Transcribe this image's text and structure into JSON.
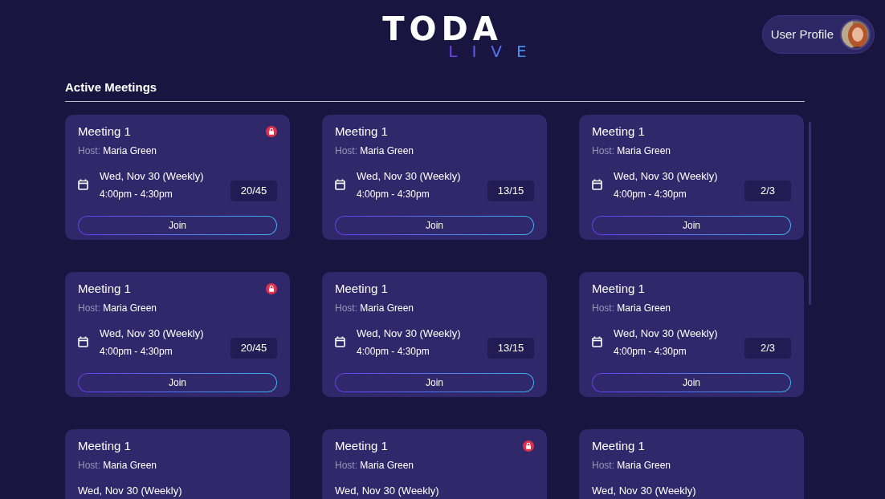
{
  "logo": {
    "title": "TODA",
    "subtitle": "LIVE"
  },
  "profile": {
    "label": "User Profile"
  },
  "section": {
    "title": "Active Meetings"
  },
  "meetings": [
    {
      "title": "Meeting 1",
      "host_label": "Host:",
      "host": "Maria Green",
      "date": "Wed, Nov 30 (Weekly)",
      "time": "4:00pm - 4:30pm",
      "count": "20/45",
      "locked": true,
      "button": "Join"
    },
    {
      "title": "Meeting 1",
      "host_label": "Host:",
      "host": "Maria Green",
      "date": "Wed, Nov 30 (Weekly)",
      "time": "4:00pm - 4:30pm",
      "count": "13/15",
      "locked": false,
      "button": "Join"
    },
    {
      "title": "Meeting 1",
      "host_label": "Host:",
      "host": "Maria Green",
      "date": "Wed, Nov 30 (Weekly)",
      "time": "4:00pm - 4:30pm",
      "count": "2/3",
      "locked": false,
      "button": "Join"
    },
    {
      "title": "Meeting 1",
      "host_label": "Host:",
      "host": "Maria Green",
      "date": "Wed, Nov 30 (Weekly)",
      "time": "4:00pm - 4:30pm",
      "count": "20/45",
      "locked": true,
      "button": "Join"
    },
    {
      "title": "Meeting 1",
      "host_label": "Host:",
      "host": "Maria Green",
      "date": "Wed, Nov 30 (Weekly)",
      "time": "4:00pm - 4:30pm",
      "count": "13/15",
      "locked": false,
      "button": "Join"
    },
    {
      "title": "Meeting 1",
      "host_label": "Host:",
      "host": "Maria Green",
      "date": "Wed, Nov 30 (Weekly)",
      "time": "4:00pm - 4:30pm",
      "count": "2/3",
      "locked": false,
      "button": "Join"
    },
    {
      "title": "Meeting 1",
      "host_label": "Host:",
      "host": "Maria Green",
      "date": "Wed, Nov 30 (Weekly)",
      "locked": false
    },
    {
      "title": "Meeting 1",
      "host_label": "Host:",
      "host": "Maria Green",
      "date": "Wed, Nov 30 (Weekly)",
      "locked": true
    },
    {
      "title": "Meeting 1",
      "host_label": "Host:",
      "host": "Maria Green",
      "date": "Wed, Nov 30 (Weekly)",
      "locked": false
    }
  ]
}
